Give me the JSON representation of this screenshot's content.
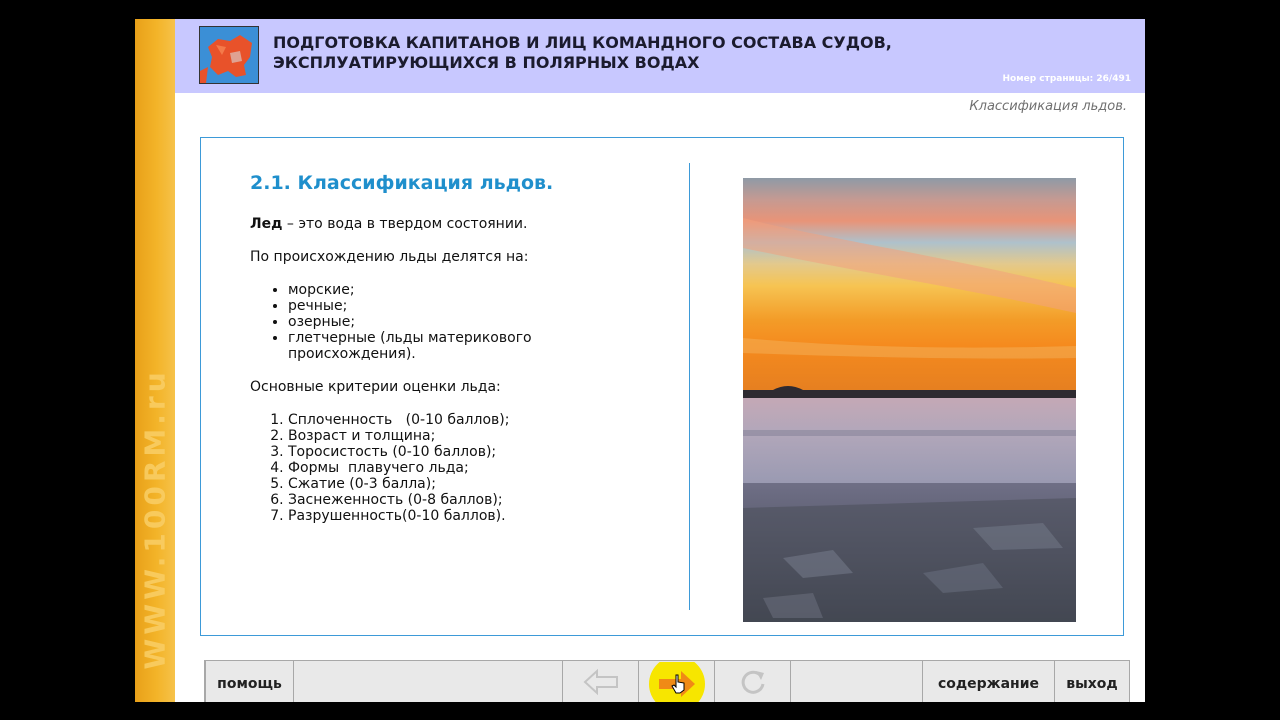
{
  "header": {
    "title_line1": "ПОДГОТОВКА КАПИТАНОВ И ЛИЦ КОМАНДНОГО СОСТАВА СУДОВ,",
    "title_line2": "ЭКСПЛУАТИРУЮЩИХСЯ В ПОЛЯРНЫХ ВОДАХ",
    "page_number": "Номер страницы: 26/491"
  },
  "topic": "Классификация льдов.",
  "watermark": "WWW.100RM.ru",
  "content": {
    "heading": "2.1. Классификация льдов.",
    "definition_bold": "Лед",
    "definition_rest": " – это вода в твердом состоянии.",
    "origin_intro": "По происхождению льды делятся на:",
    "origin_items": [
      "морские;",
      "речные;",
      "озерные;",
      "глетчерные (льды материкового происхождения)."
    ],
    "criteria_intro": "Основные критерии оценки льда:",
    "criteria_items": [
      "Сплоченность   (0-10 баллов);",
      "Возраст и толщина;",
      "Торосистость (0-10 баллов);",
      "Формы  плавучего льда;",
      "Сжатие (0-3 балла);",
      "Заснеженность (0-8 баллов);",
      "Разрушенность(0-10 баллов)."
    ]
  },
  "toolbar": {
    "help_label": "помощь",
    "contents_label": "содержание",
    "exit_label": "выход",
    "back_icon": "arrow-left-icon",
    "forward_icon": "arrow-right-icon",
    "reload_icon": "reload-icon"
  },
  "colors": {
    "header_bg": "#c8c8ff",
    "accent_blue": "#1f8fcc",
    "sideband_orange": "#f3b429",
    "forward_highlight": "#f7e600",
    "forward_arrow": "#f08a16"
  }
}
